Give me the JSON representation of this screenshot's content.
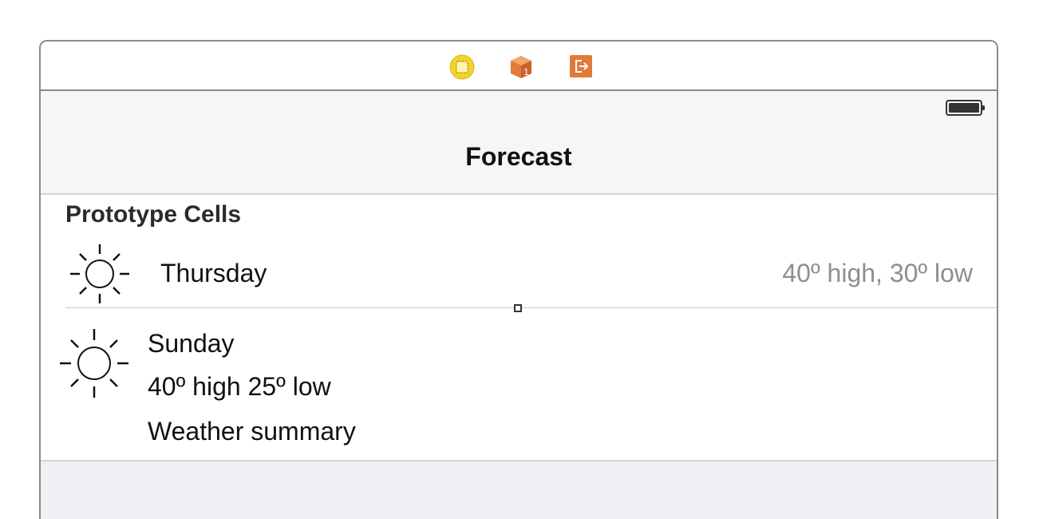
{
  "dock": {
    "icons": [
      "view-controller-icon",
      "first-responder-icon",
      "exit-icon"
    ]
  },
  "navbar": {
    "title": "Forecast"
  },
  "table": {
    "section_header": "Prototype Cells",
    "cells": [
      {
        "icon": "sun-icon",
        "title": "Thursday",
        "detail": "40º high, 30º low"
      },
      {
        "icon": "sun-icon",
        "title": "Sunday",
        "temps": "40º high 25º low",
        "summary": "Weather summary"
      }
    ]
  },
  "colors": {
    "view_controller_icon": "#f5d033",
    "object_icon": "#e07b39",
    "exit_icon": "#e07b39",
    "detail_text": "#8e8e93",
    "navbar_bg": "#f6f6f6"
  }
}
